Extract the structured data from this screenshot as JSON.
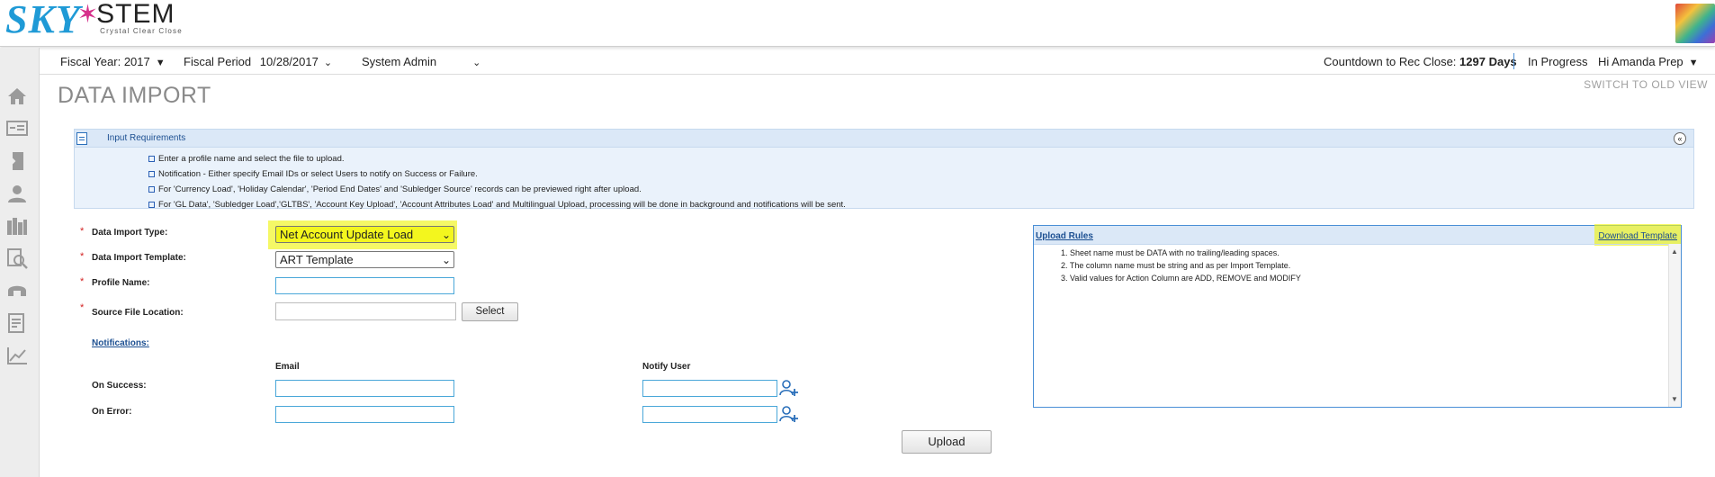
{
  "brand": {
    "logo_left": "SKY",
    "logo_right": "STEM",
    "tagline": "Crystal Clear Close"
  },
  "sidebar": {
    "icons": [
      "home-icon",
      "dashboard-icon",
      "import-icon",
      "user-icon",
      "library-icon",
      "search-report-icon",
      "support-icon",
      "checklist-icon",
      "chart-icon"
    ]
  },
  "filter_bar": {
    "fiscal_year": "Fiscal Year: 2017",
    "fiscal_period_label": "Fiscal Period",
    "fiscal_period_value": "10/28/2017",
    "role": "System Admin",
    "countdown_label": "Countdown to Rec Close:",
    "countdown_value": "1297 Days",
    "status": "In Progress",
    "greeting": "Hi Amanda Prep"
  },
  "page": {
    "title": "DATA IMPORT",
    "switch_link": "SWITCH TO OLD VIEW"
  },
  "input_requirements": {
    "title": "Input Requirements",
    "collapse_symbol": "«",
    "items": [
      "Enter a profile name and select the file to upload.",
      "Notification - Either specify Email IDs or select Users to notify on Success or Failure.",
      "For 'Currency Load', 'Holiday Calendar', 'Period End Dates' and 'Subledger Source' records can be previewed right after upload.",
      "For 'GL Data', 'Subledger Load','GLTBS', 'Account Key Upload', 'Account Attributes Load' and Multilingual Upload, processing will be done in background and notifications will be sent."
    ]
  },
  "form": {
    "required_marker": "*",
    "import_type_label": "Data Import Type:",
    "import_type_value": "Net Account Update Load",
    "template_label": "Data Import Template:",
    "template_value": "ART Template",
    "profile_label": "Profile Name:",
    "source_label": "Source File Location:",
    "select_button": "Select",
    "notifications_link": "Notifications:",
    "email_header": "Email",
    "notify_user_header": "Notify User",
    "on_success_label": "On Success:",
    "on_error_label": "On Error:",
    "upload_button": "Upload"
  },
  "upload_rules": {
    "title": "Upload Rules",
    "download_link": "Download Template",
    "rules": [
      "1. Sheet name must be DATA with no trailing/leading spaces.",
      "2. The column name must be string and as per Import Template.",
      "3. Valid values for Action Column are ADD, REMOVE and MODIFY"
    ]
  },
  "colors": {
    "brand_blue": "#1f9ad6",
    "brand_pink": "#d6308b",
    "link_blue": "#1c4f91",
    "highlight_yellow": "#f3f61e",
    "required_red": "#d32121"
  }
}
